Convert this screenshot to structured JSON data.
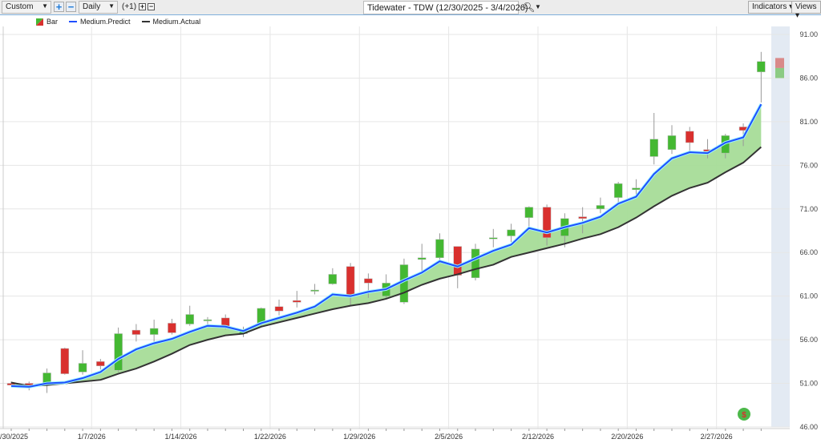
{
  "toolbar": {
    "range_select": "Custom",
    "period_select": "Daily",
    "offset": "(+1)",
    "title": "Tidewater - TDW (12/30/2025 - 3/4/2026)",
    "indicators": "Indicators",
    "views": "Views",
    "zoom_in": "+",
    "zoom_out": "−",
    "plus": "+",
    "minus": "−"
  },
  "legend": {
    "bar": "Bar",
    "predict": "Medium.Predict",
    "actual": "Medium.Actual"
  },
  "colors": {
    "up": "#44b832",
    "down": "#d9302e",
    "predict": "#1f4fff",
    "actual": "#333333",
    "fill": "#a6dc98"
  },
  "chart_data": {
    "type": "candlestick",
    "ylim": [
      46,
      91
    ],
    "y_ticks": [
      "46.00",
      "51.00",
      "56.00",
      "61.00",
      "66.00",
      "71.00",
      "76.00",
      "81.00",
      "86.00",
      "91.00"
    ],
    "x_ticks": [
      {
        "label": "/30/2025",
        "index": 0
      },
      {
        "label": "1/7/2026",
        "index": 4.5
      },
      {
        "label": "1/14/2026",
        "index": 9.5
      },
      {
        "label": "1/22/2026",
        "index": 14.5
      },
      {
        "label": "1/29/2026",
        "index": 19.5
      },
      {
        "label": "2/5/2026",
        "index": 24.5
      },
      {
        "label": "2/12/2026",
        "index": 29.5
      },
      {
        "label": "2/20/2026",
        "index": 34.5
      },
      {
        "label": "2/27/2026",
        "index": 39.5
      }
    ],
    "ohlc": [
      [
        51.0,
        51.2,
        50.8,
        50.8
      ],
      [
        51.0,
        51.2,
        50.2,
        50.6
      ],
      [
        50.8,
        52.7,
        49.9,
        52.2
      ],
      [
        55.0,
        55.1,
        52.0,
        52.1
      ],
      [
        52.3,
        54.8,
        52.0,
        53.3
      ],
      [
        53.5,
        53.8,
        52.6,
        53.0
      ],
      [
        52.5,
        57.4,
        52.3,
        56.7
      ],
      [
        57.1,
        57.8,
        55.8,
        56.6
      ],
      [
        56.6,
        58.3,
        55.8,
        57.3
      ],
      [
        57.9,
        58.4,
        56.6,
        56.8
      ],
      [
        57.8,
        59.9,
        57.6,
        58.9
      ],
      [
        58.3,
        58.6,
        57.8,
        58.3
      ],
      [
        58.5,
        58.9,
        57.2,
        57.5
      ],
      [
        56.7,
        57.5,
        56.3,
        57.0
      ],
      [
        57.9,
        59.7,
        57.6,
        59.6
      ],
      [
        59.8,
        60.6,
        58.8,
        59.3
      ],
      [
        60.5,
        61.6,
        59.7,
        60.3
      ],
      [
        61.7,
        62.4,
        61.2,
        61.7
      ],
      [
        62.4,
        64.2,
        62.3,
        63.5
      ],
      [
        64.4,
        64.8,
        59.9,
        61.0
      ],
      [
        63.0,
        63.6,
        60.8,
        62.5
      ],
      [
        61.0,
        63.5,
        60.8,
        62.5
      ],
      [
        60.3,
        65.3,
        60.1,
        64.6
      ],
      [
        65.2,
        67.0,
        63.5,
        65.4
      ],
      [
        65.4,
        68.2,
        65.2,
        67.5
      ],
      [
        66.7,
        66.7,
        61.9,
        63.4
      ],
      [
        63.1,
        67.0,
        62.8,
        66.4
      ],
      [
        67.6,
        68.7,
        66.6,
        67.7
      ],
      [
        67.9,
        69.3,
        67.2,
        68.6
      ],
      [
        70.0,
        71.3,
        69.0,
        71.2
      ],
      [
        71.2,
        71.5,
        66.8,
        67.7
      ],
      [
        67.9,
        70.5,
        66.6,
        69.9
      ],
      [
        70.1,
        71.2,
        68.2,
        69.9
      ],
      [
        71.0,
        72.3,
        70.5,
        71.4
      ],
      [
        72.3,
        74.1,
        71.6,
        73.9
      ],
      [
        73.2,
        74.4,
        72.3,
        73.4
      ],
      [
        77.0,
        82.0,
        76.1,
        79.0
      ],
      [
        77.8,
        80.6,
        77.3,
        79.4
      ],
      [
        79.9,
        80.4,
        77.6,
        78.6
      ],
      [
        77.8,
        79.0,
        76.8,
        77.6
      ],
      [
        77.4,
        79.6,
        76.8,
        79.4
      ],
      [
        80.4,
        80.8,
        78.2,
        80.0
      ],
      [
        86.7,
        89.0,
        83.2,
        87.9
      ]
    ],
    "series": [
      {
        "name": "Medium.Predict",
        "values": [
          50.7,
          50.6,
          51.0,
          51.1,
          51.6,
          52.3,
          53.8,
          54.9,
          55.6,
          56.1,
          56.9,
          57.6,
          57.5,
          57.0,
          57.9,
          58.5,
          59.1,
          59.8,
          61.2,
          61.0,
          61.5,
          61.8,
          62.8,
          63.7,
          65.0,
          64.4,
          65.3,
          66.2,
          66.9,
          68.8,
          68.3,
          68.9,
          69.4,
          70.1,
          71.6,
          72.4,
          75.0,
          76.8,
          77.5,
          77.4,
          78.6,
          79.2,
          83.0
        ]
      },
      {
        "name": "Medium.Actual",
        "values": [
          51.1,
          50.7,
          50.8,
          51.0,
          51.2,
          51.4,
          52.1,
          52.7,
          53.5,
          54.4,
          55.4,
          56.0,
          56.5,
          56.7,
          57.5,
          58.0,
          58.5,
          59.0,
          59.5,
          59.9,
          60.2,
          60.7,
          61.4,
          62.3,
          63.0,
          63.5,
          64.1,
          64.6,
          65.5,
          66.0,
          66.5,
          67.0,
          67.6,
          68.1,
          68.9,
          70.0,
          71.3,
          72.5,
          73.4,
          74.0,
          75.2,
          76.3,
          78.1
        ]
      }
    ],
    "forecast_bar": {
      "high": 88.3,
      "low": 86.0
    }
  }
}
